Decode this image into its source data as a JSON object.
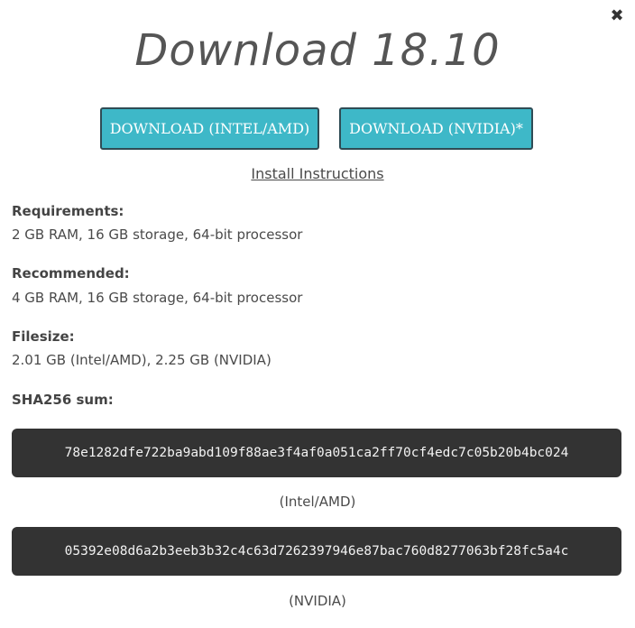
{
  "dialog": {
    "close_symbol": "✖",
    "title": "Download 18.10"
  },
  "buttons": {
    "intel_amd": "DOWNLOAD (INTEL/AMD)",
    "nvidia": "DOWNLOAD (NVIDIA)*"
  },
  "install_link": "Install Instructions",
  "specs": {
    "requirements": {
      "label": "Requirements:",
      "value": "2 GB RAM, 16 GB storage, 64-bit processor"
    },
    "recommended": {
      "label": "Recommended:",
      "value": "4 GB RAM, 16 GB storage, 64-bit processor"
    },
    "filesize": {
      "label": "Filesize:",
      "value": "2.01 GB (Intel/AMD), 2.25 GB (NVIDIA)"
    },
    "sha256": {
      "label": "SHA256 sum:"
    }
  },
  "hashes": [
    {
      "value": "78e1282dfe722ba9abd109f88ae3f4af0a051ca2ff70cf4edc7c05b20b4bc024",
      "caption": "(Intel/AMD)"
    },
    {
      "value": "05392e08d6a2b3eeb3b32c4c63d7262397946e87bac760d8277063bf28fc5a4c",
      "caption": "(NVIDIA)"
    }
  ],
  "colors": {
    "button_bg": "#3eb8c8",
    "button_border": "#2f4c55",
    "hash_bg": "#333333"
  }
}
